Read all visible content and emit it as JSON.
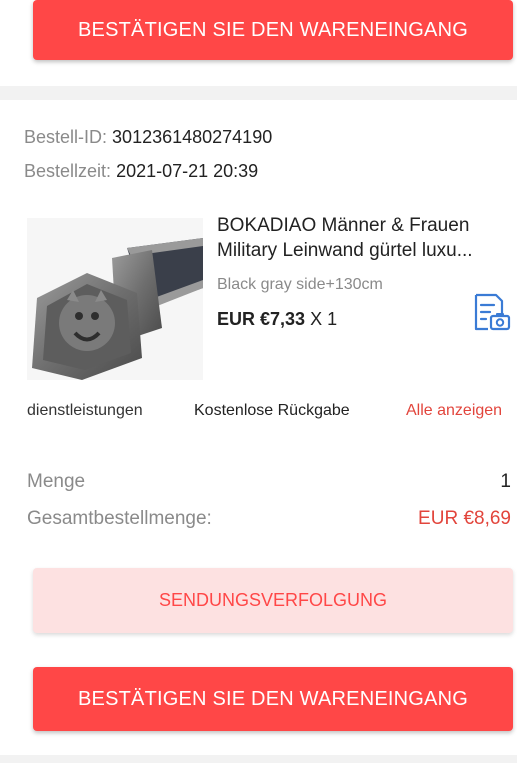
{
  "top_button": {
    "label": "BESTÄTIGEN SIE DEN WARENEINGANG"
  },
  "order": {
    "id_label": "Bestell-ID:",
    "id_value": "3012361480274190",
    "time_label": "Bestellzeit:",
    "time_value": "2021-07-21 20:39"
  },
  "product": {
    "title_line1": "BOKADIAO Männer & Frauen",
    "title_line2": "Military Leinwand gürtel luxu...",
    "variant": "Black gray side+130cm",
    "price": "EUR €7,33",
    "quantity": "X 1",
    "image_icon": "belt-buckle-tiger-image",
    "action_icon": "document-camera-icon"
  },
  "services": {
    "label": "dienstleistungen",
    "value": "Kostenlose Rückgabe",
    "link": "Alle anzeigen"
  },
  "summary": {
    "quantity_label": "Menge",
    "quantity_value": "1",
    "total_label": "Gesamtbestellmenge:",
    "total_value": "EUR €8,69"
  },
  "tracking_button": {
    "label": "SENDUNGSVERFOLGUNG"
  },
  "bottom_button": {
    "label": "BESTÄTIGEN SIE DEN WARENEINGANG"
  },
  "colors": {
    "accent": "#ff4747",
    "tracking_bg": "#fde1e1",
    "muted": "#8a8a8a",
    "link_icon": "#3a7bd5"
  }
}
